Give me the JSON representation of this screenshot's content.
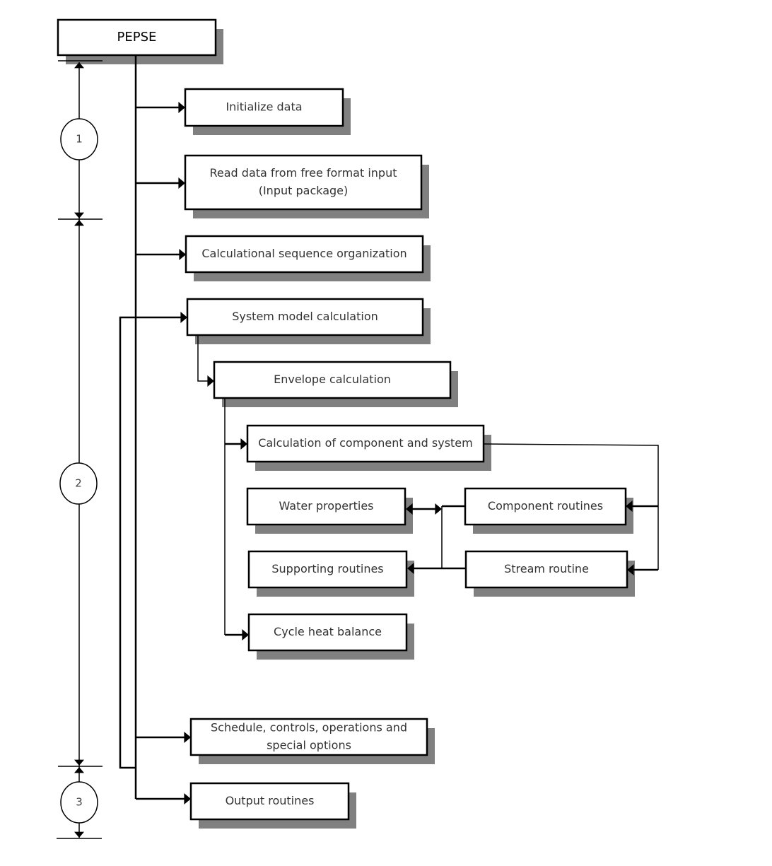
{
  "diagram": {
    "root": {
      "label": "PEPSE"
    },
    "nodes": {
      "initialize": {
        "lines": [
          "Initialize data"
        ]
      },
      "read_data": {
        "lines": [
          "Read data from free format input",
          "(Input package)"
        ]
      },
      "calc_sequence": {
        "lines": [
          "Calculational sequence organization"
        ]
      },
      "system_model": {
        "lines": [
          "System model calculation"
        ]
      },
      "envelope": {
        "lines": [
          "Envelope calculation"
        ]
      },
      "component_system": {
        "lines": [
          "Calculation of component and system"
        ]
      },
      "water_properties": {
        "lines": [
          "Water properties"
        ]
      },
      "component_routines": {
        "lines": [
          "Component routines"
        ]
      },
      "supporting_routines": {
        "lines": [
          "Supporting routines"
        ]
      },
      "stream_routine": {
        "lines": [
          "Stream routine"
        ]
      },
      "cycle_heat_balance": {
        "lines": [
          "Cycle heat balance"
        ]
      },
      "schedule": {
        "lines": [
          "Schedule, controls, operations and",
          "special options"
        ]
      },
      "output": {
        "lines": [
          "Output routines"
        ]
      }
    },
    "phases": [
      {
        "label": "1"
      },
      {
        "label": "2"
      },
      {
        "label": "3"
      }
    ]
  }
}
